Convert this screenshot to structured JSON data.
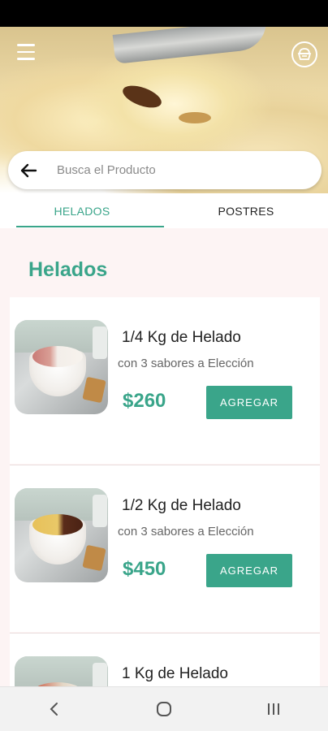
{
  "search": {
    "placeholder": "Busca el Producto",
    "value": ""
  },
  "tabs": [
    {
      "label": "HELADOS",
      "active": true
    },
    {
      "label": "POSTRES",
      "active": false
    }
  ],
  "section": {
    "title": "Helados"
  },
  "products": [
    {
      "title": "1/4 Kg de Helado",
      "subtitle": "con 3 sabores a Elección",
      "price": "$260",
      "button": "AGREGAR"
    },
    {
      "title": "1/2 Kg de Helado",
      "subtitle": "con 3 sabores a Elección",
      "price": "$450",
      "button": "AGREGAR"
    },
    {
      "title": "1 Kg de Helado",
      "subtitle": "",
      "price": "",
      "button": ""
    }
  ],
  "icons": {
    "menu": "menu-icon",
    "profile": "ice-cream-profile-icon",
    "back": "arrow-left-icon",
    "nav_back": "chevron-left-icon",
    "nav_home": "home-circle-icon",
    "nav_recents": "recents-icon"
  },
  "colors": {
    "accent": "#3aa58a",
    "background": "#fdf4f4"
  }
}
